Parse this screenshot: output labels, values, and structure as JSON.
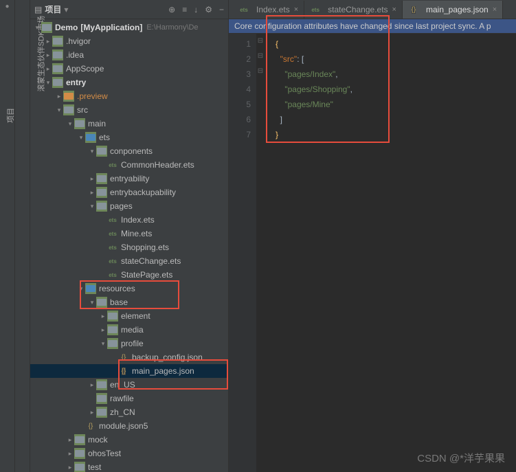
{
  "panel": {
    "title": "项目",
    "v1": "滚蒙生态伙伴SDK市场",
    "v2": "项目"
  },
  "toolbar": {
    "target": "⊕",
    "flatten": "≡",
    "select": "↓",
    "gear": "⚙",
    "collapse": "−"
  },
  "tree": {
    "demo": {
      "name": "Demo",
      "app": "[MyApplication]",
      "path": "E:\\Harmony\\De"
    },
    "hvigor": ".hvigor",
    "idea": ".idea",
    "appscope": "AppScope",
    "entry": "entry",
    "preview": ".preview",
    "src": "src",
    "main": "main",
    "ets": "ets",
    "conponents": "conponents",
    "commonheader": "CommonHeader.ets",
    "entryability": "entryability",
    "entrybackup": "entrybackupability",
    "pages": "pages",
    "index": "Index.ets",
    "mine": "Mine.ets",
    "shopping": "Shopping.ets",
    "statechange": "stateChange.ets",
    "statepage": "StatePage.ets",
    "resources": "resources",
    "base": "base",
    "element": "element",
    "media": "media",
    "profile": "profile",
    "backup": "backup_config.json",
    "mainpages": "main_pages.json",
    "enus": "en_US",
    "rawfile": "rawfile",
    "zhcn": "zh_CN",
    "module": "module.json5",
    "mock": "mock",
    "ohostest": "ohosTest",
    "test": "test"
  },
  "tabs": {
    "t1": "Index.ets",
    "t2": "stateChange.ets",
    "t3": "main_pages.json"
  },
  "notice": "Core configuration attributes have changed since last project sync. A p",
  "code": {
    "l1": "{",
    "l2a": "\"src\"",
    "l2b": ": [",
    "l3": "\"pages/Index\"",
    "l3c": ",",
    "l4": "\"pages/Shopping\"",
    "l4c": ",",
    "l5": "\"pages/Mine\"",
    "l6": "]",
    "l7": "}"
  },
  "watermark": "CSDN @*洋芋果果"
}
